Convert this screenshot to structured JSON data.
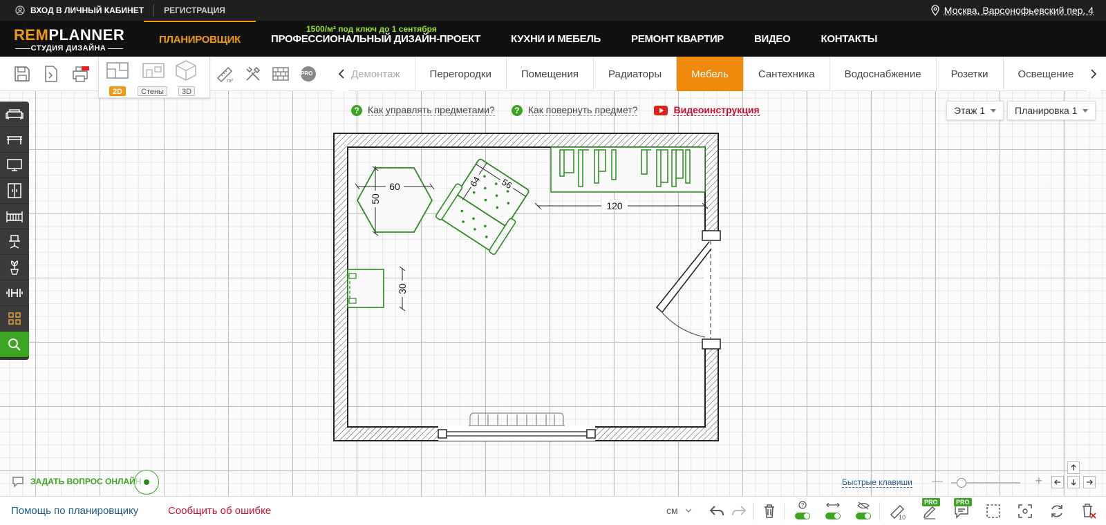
{
  "topbar": {
    "login_label": "ВХОД В ЛИЧНЫЙ КАБИНЕТ",
    "register_label": "РЕГИСТРАЦИЯ",
    "address": "Москва, Варсонофьевский пер. 4"
  },
  "logo": {
    "part1": "REM",
    "part2": "PLANNER",
    "subtitle": "СТУДИЯ ДИЗАЙНА"
  },
  "nav": {
    "promo": "1500/м² под ключ до 1 сентября",
    "items": [
      "ПЛАНИРОВЩИК",
      "ПРОФЕССИОНАЛЬНЫЙ ДИЗАЙН-ПРОЕКТ",
      "КУХНИ И МЕБЕЛЬ",
      "РЕМОНТ КВАРТИР",
      "ВИДЕО",
      "КОНТАКТЫ"
    ],
    "active": "ПЛАНИРОВЩИК"
  },
  "toolbar": {
    "views": [
      "2D",
      "Стены",
      "3D"
    ],
    "active_view": "2D",
    "pro_badge": "PRO",
    "tabs": [
      "Демонтаж",
      "Перегородки",
      "Помещения",
      "Радиаторы",
      "Мебель",
      "Сантехника",
      "Водоснабжение",
      "Розетки",
      "Освещение"
    ],
    "active_tab": "Мебель"
  },
  "help": {
    "link1": "Как управлять предметами?",
    "link2": "Как повернуть предмет?",
    "video": "Видеоинструкция"
  },
  "floor_select": {
    "value": "Этаж 1"
  },
  "layout_select": {
    "value": "Планировка 1"
  },
  "plan": {
    "dims": {
      "hex_width": "60",
      "hex_height": "50",
      "sofa_width": "56",
      "sofa_depth": "64",
      "wardrobe_width": "120",
      "cabinet_depth": "30"
    },
    "accent": "#2a8a1e"
  },
  "chat": {
    "label": "ЗАДАТЬ ВОПРОС ОНЛАЙН"
  },
  "zoom": {
    "hotkeys_label": "Быстрые клавиши",
    "level": 0.15
  },
  "statusbar": {
    "help_link": "Помощь по планировщику",
    "report_link": "Сообщить об ошибке",
    "units": "см",
    "pro_badge": "PRO"
  },
  "colors": {
    "accent_orange": "#ef8a0c",
    "accent_green": "#3ba521",
    "dark": "#1f1f1f"
  }
}
